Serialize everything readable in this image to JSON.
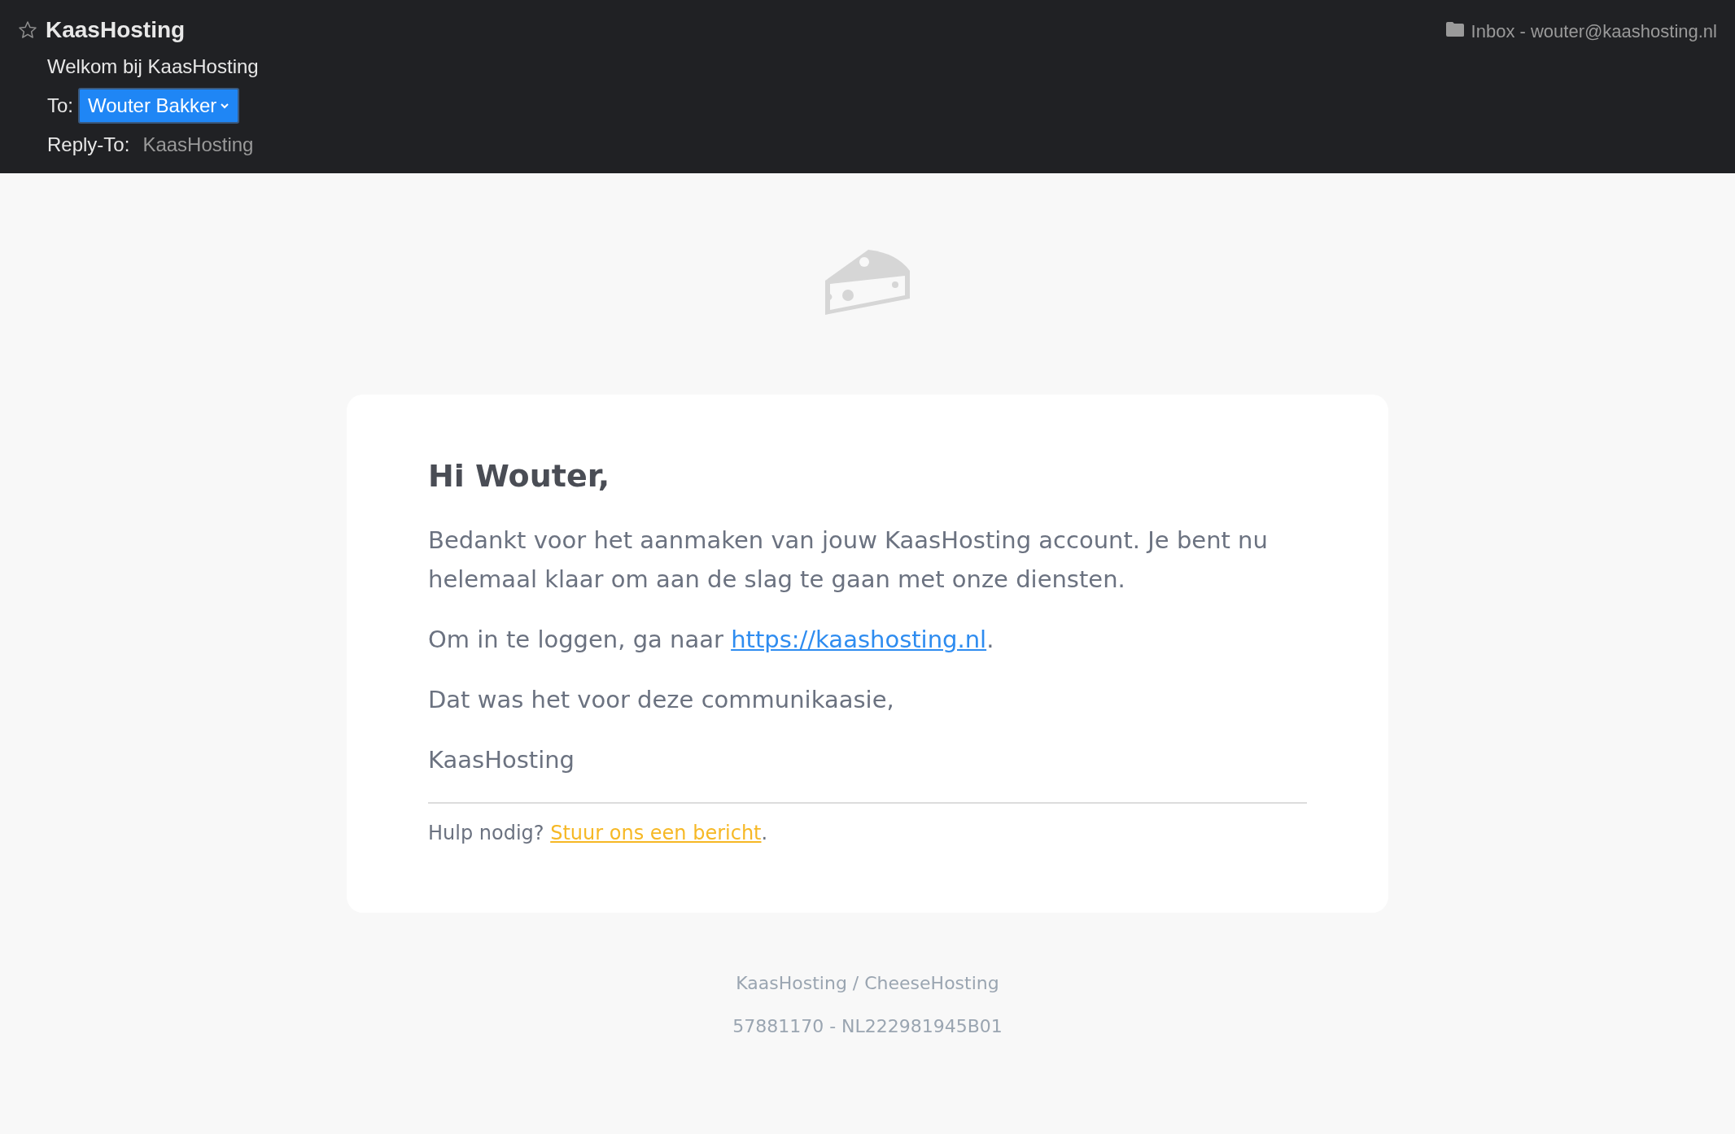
{
  "message_header": {
    "sender": "KaasHosting",
    "starred": false,
    "subject": "Welkom bij KaasHosting",
    "to_label": "To:",
    "to": "Wouter Bakker",
    "reply_to_label": "Reply-To:",
    "reply_to": "KaasHosting",
    "mailbox": "Inbox - wouter@kaashosting.nl"
  },
  "email": {
    "greeting": "Hi Wouter,",
    "body": [
      {
        "kind": "text",
        "text": "Bedankt voor het aanmaken van jouw KaasHosting account. Je bent nu helemaal klaar om aan de slag te gaan met onze diensten."
      },
      {
        "kind": "link_line",
        "before": "Om in te loggen, ga naar ",
        "link": "https://kaashosting.nl",
        "after": "."
      },
      {
        "kind": "text",
        "text": "Dat was het voor deze communikaasie,"
      },
      {
        "kind": "text",
        "text": "KaasHosting"
      }
    ],
    "help": {
      "before": "Hulp nodig? ",
      "link": "Stuur ons een bericht",
      "after": "."
    },
    "footer": [
      "KaasHosting / CheeseHosting",
      "57881170 - NL222981945B01"
    ]
  }
}
